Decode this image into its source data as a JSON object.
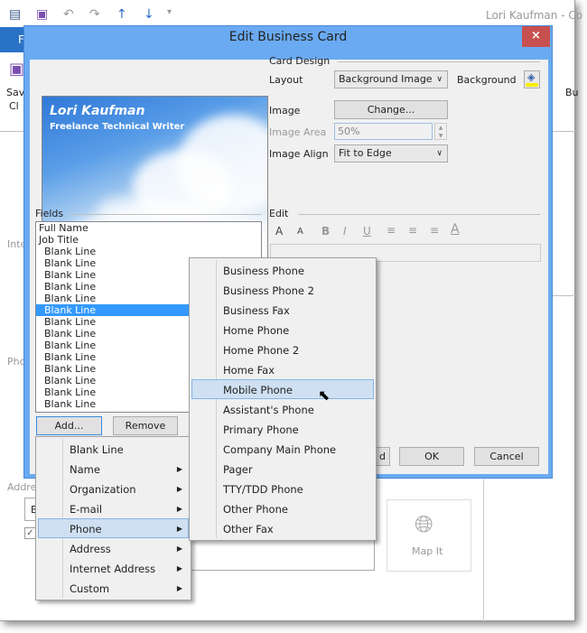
{
  "app": {
    "window_title": "Lori Kaufman - Co",
    "file_tab": "F",
    "ribbon_left": [
      "Sav",
      "Cl"
    ],
    "ribbon_right": "Bu",
    "labels": {
      "internet": "Inte",
      "phone": "Pho",
      "address": "Addre"
    },
    "address_field": "B",
    "map_it": "Map It",
    "qat_icons": [
      "contact-card-icon",
      "save-icon",
      "undo-icon",
      "redo-icon",
      "up-arrow-icon",
      "down-arrow-icon",
      "customize-icon"
    ]
  },
  "dialog": {
    "title": "Edit Business Card",
    "close": "×",
    "card": {
      "name": "Lori Kaufman",
      "job": "Freelance Technical Writer"
    },
    "card_design": {
      "header": "Card Design",
      "layout_label": "Layout",
      "layout_value": "Background Image",
      "background_label": "Background",
      "image_label": "Image",
      "change_button": "Change...",
      "image_area_label": "Image Area",
      "image_area_value": "50%",
      "image_align_label": "Image Align",
      "image_align_value": "Fit to Edge"
    },
    "fields": {
      "header": "Fields",
      "items": [
        "Full Name",
        "Job Title",
        "Blank Line",
        "Blank Line",
        "Blank Line",
        "Blank Line",
        "Blank Line",
        "Blank Line",
        "Blank Line",
        "Blank Line",
        "Blank Line",
        "Blank Line",
        "Blank Line",
        "Blank Line",
        "Blank Line",
        "Blank Line"
      ],
      "selected_index": 8,
      "add_button": "Add...",
      "remove_button": "Remove"
    },
    "edit": {
      "header": "Edit",
      "toolbar": [
        "A",
        "A",
        "B",
        "I",
        "U"
      ]
    },
    "buttons": {
      "partial": "d",
      "ok": "OK",
      "cancel": "Cancel"
    }
  },
  "add_menu": {
    "items": [
      {
        "label": "Blank Line",
        "submenu": false
      },
      {
        "label": "Name",
        "submenu": true
      },
      {
        "label": "Organization",
        "submenu": true
      },
      {
        "label": "E-mail",
        "submenu": true
      },
      {
        "label": "Phone",
        "submenu": true,
        "highlighted": true
      },
      {
        "label": "Address",
        "submenu": true
      },
      {
        "label": "Internet Address",
        "submenu": true
      },
      {
        "label": "Custom",
        "submenu": true
      }
    ]
  },
  "phone_menu": {
    "items": [
      "Business Phone",
      "Business Phone 2",
      "Business Fax",
      "Home Phone",
      "Home Phone 2",
      "Home Fax",
      "Mobile Phone",
      "Assistant's Phone",
      "Primary Phone",
      "Company Main Phone",
      "Pager",
      "TTY/TDD Phone",
      "Other Phone",
      "Other Fax"
    ],
    "highlighted": "Mobile Phone"
  },
  "colors": {
    "accent": "#3399ff",
    "title_bar": "#6aaaf2",
    "close": "#c75050",
    "file_tab": "#2a72c6"
  }
}
